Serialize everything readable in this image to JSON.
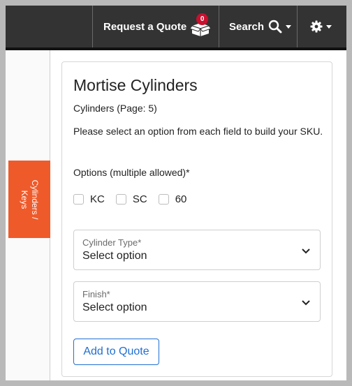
{
  "nav": {
    "quote_label": "Request a Quote",
    "quote_count": "0",
    "search_label": "Search"
  },
  "sidebar": {
    "tab_label": "Cylinders /\nKeys"
  },
  "product": {
    "title": "Mortise Cylinders",
    "subtitle": "Cylinders (Page: 5)",
    "instructions": "Please select an option from each field to build your SKU.",
    "options_label": "Options (multiple allowed)*",
    "options": [
      "KC",
      "SC",
      "60"
    ]
  },
  "fields": {
    "cylinder_type": {
      "label": "Cylinder Type*",
      "value": "Select option"
    },
    "finish": {
      "label": "Finish*",
      "value": "Select option"
    }
  },
  "actions": {
    "add_label": "Add to Quote"
  },
  "colors": {
    "topbar": "#333333",
    "sidetab": "#ef5a2a",
    "badge": "#c8102e",
    "link_blue": "#1f6fd1"
  },
  "icons": [
    "quote-box-icon",
    "search-icon",
    "gear-icon",
    "chevron-down-icon"
  ]
}
